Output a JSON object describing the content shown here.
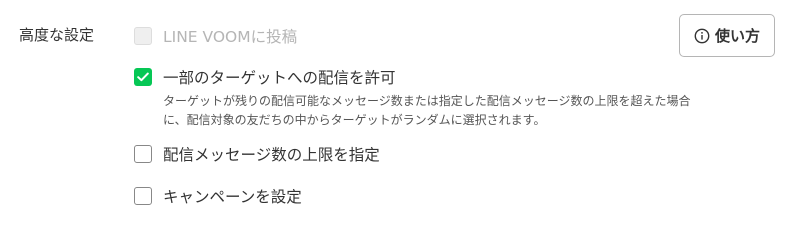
{
  "section": {
    "label": "高度な設定"
  },
  "options": [
    {
      "label": "LINE VOOMに投稿",
      "checked": false,
      "disabled": true
    },
    {
      "label": "一部のターゲットへの配信を許可",
      "checked": true,
      "disabled": false,
      "description_line1": "ターゲットが残りの配信可能なメッセージ数または指定した配信メッセージ数の上限を超えた場合",
      "description_line2": "に、配信対象の友だちの中からターゲットがランダムに選択されます。"
    },
    {
      "label": "配信メッセージ数の上限を指定",
      "checked": false,
      "disabled": false
    },
    {
      "label": "キャンペーンを設定",
      "checked": false,
      "disabled": false
    }
  ],
  "help_button": {
    "label": "使い方",
    "icon": "info-circle-icon"
  },
  "colors": {
    "accent_green": "#06c755",
    "disabled_text": "#b5b5b5",
    "text": "#333333"
  }
}
